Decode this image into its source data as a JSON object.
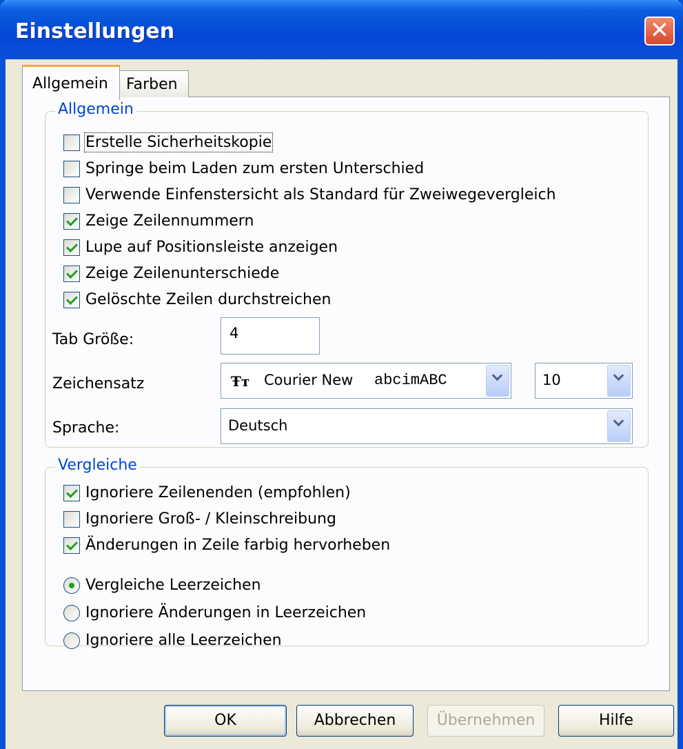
{
  "window": {
    "title": "Einstellungen",
    "close_label": "✕"
  },
  "tabs": [
    {
      "label": "Allgemein"
    },
    {
      "label": "Farben"
    }
  ],
  "general": {
    "legend": "Allgemein",
    "options": [
      {
        "label": "Erstelle Sicherheitskopie",
        "checked": false
      },
      {
        "label": "Springe beim Laden zum ersten Unterschied",
        "checked": false
      },
      {
        "label": "Verwende Einfenstersicht als Standard für Zweiwegevergleich",
        "checked": false
      },
      {
        "label": "Zeige Zeilennummern",
        "checked": true
      },
      {
        "label": "Lupe auf Positionsleiste anzeigen",
        "checked": true
      },
      {
        "label": "Zeige Zeilenunterschiede",
        "checked": true
      },
      {
        "label": "Gelöschte Zeilen durchstreichen",
        "checked": true
      }
    ],
    "tab_size_label": "Tab Größe:",
    "tab_size_value": "4",
    "font_label": "Zeichensatz",
    "font_icon": "Ŧт",
    "font_name": "Courier New",
    "font_sample": "abcimABC",
    "font_size": "10",
    "language_label": "Sprache:",
    "language_value": "Deutsch"
  },
  "compare": {
    "legend": "Vergleiche",
    "options": [
      {
        "label": "Ignoriere Zeilenenden (empfohlen)",
        "checked": true
      },
      {
        "label": "Ignoriere Groß- / Kleinschreibung",
        "checked": false
      },
      {
        "label": "Änderungen in Zeile farbig hervorheben",
        "checked": true
      }
    ],
    "whitespace": [
      {
        "label": "Vergleiche Leerzeichen",
        "selected": true
      },
      {
        "label": "Ignoriere Änderungen in Leerzeichen",
        "selected": false
      },
      {
        "label": "Ignoriere alle Leerzeichen",
        "selected": false
      }
    ]
  },
  "buttons": {
    "ok": "OK",
    "cancel": "Abbrechen",
    "apply": "Übernehmen",
    "help": "Hilfe"
  }
}
